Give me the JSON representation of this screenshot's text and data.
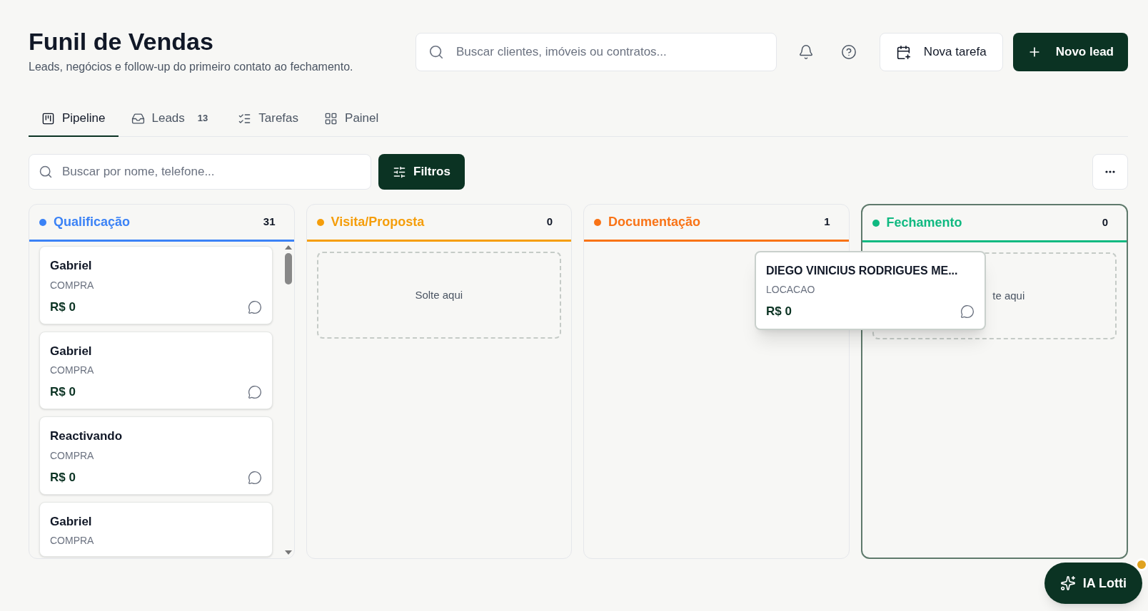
{
  "header": {
    "title": "Funil de Vendas",
    "subtitle": "Leads, negócios e follow-up do primeiro contato ao fechamento."
  },
  "global_search": {
    "placeholder": "Buscar clientes, imóveis ou contratos..."
  },
  "new_task_button": {
    "label": "Nova tarefa"
  },
  "new_lead_button": {
    "label": "Novo lead"
  },
  "tabs": [
    {
      "kind": "pipeline",
      "label": "Pipeline",
      "selected": true
    },
    {
      "kind": "inbox",
      "label": "Leads",
      "count": "13",
      "selected": false
    },
    {
      "kind": "tasks",
      "label": "Tarefas",
      "selected": false
    },
    {
      "kind": "grid",
      "label": "Painel",
      "selected": false
    }
  ],
  "lead_search": {
    "placeholder": "Buscar por nome, telefone..."
  },
  "filters_button": {
    "label": "Filtros"
  },
  "columns": [
    {
      "title": "Qualificação",
      "count": "31",
      "color": "#3b82f6",
      "drag_over": false,
      "cards": [
        {
          "name": "Gabriel",
          "type": "COMPRA",
          "value": "R$ 0"
        },
        {
          "name": "Gabriel",
          "type": "COMPRA",
          "value": "R$ 0"
        },
        {
          "name": "Reactivando",
          "type": "COMPRA",
          "value": "R$ 0"
        },
        {
          "name": "Gabriel",
          "type": "COMPRA"
        }
      ]
    },
    {
      "title": "Visita/Proposta",
      "count": "0",
      "color": "#f59e0b",
      "drag_over": false,
      "drop_zone": "Solte aqui"
    },
    {
      "title": "Documentação",
      "count": "1",
      "color": "#f97316",
      "drag_over": false
    },
    {
      "title": "Fechamento",
      "count": "0",
      "color": "#10b981",
      "drag_over": true,
      "drop_zone": "te aqui"
    }
  ],
  "dragging_card": {
    "name": "DIEGO VINICIUS RODRIGUES ME...",
    "type": "LOCACAO",
    "value": "R$ 0"
  },
  "assistant_button": {
    "label": "IA Lotti",
    "notification": true
  }
}
